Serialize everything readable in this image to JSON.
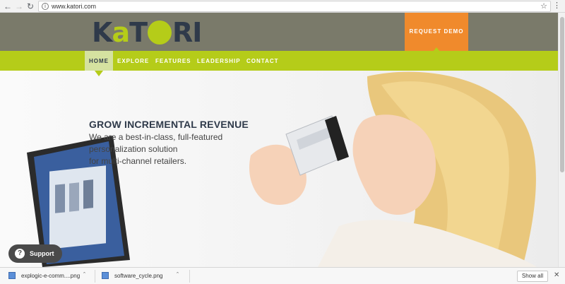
{
  "browser": {
    "url": "www.katori.com",
    "icons": [
      "back-icon",
      "forward-icon",
      "reload-icon",
      "info-icon",
      "star-icon",
      "menu-icon"
    ]
  },
  "header": {
    "logo_text": "KATORI",
    "request_demo_label": "REQUEST DEMO",
    "colors": {
      "header_bg": "#7a7a6a",
      "lime": "#b5cc19",
      "orange": "#f08a2c",
      "navy": "#2f3a4a"
    }
  },
  "nav": {
    "items": [
      {
        "label": "HOME",
        "active": true
      },
      {
        "label": "EXPLORE",
        "active": false
      },
      {
        "label": "FEATURES",
        "active": false
      },
      {
        "label": "LEADERSHIP",
        "active": false
      },
      {
        "label": "CONTACT",
        "active": false
      }
    ]
  },
  "hero": {
    "headline": "GROW INCREMENTAL REVENUE",
    "lines": [
      "We are a best-in-class, full-featured",
      "personalization solution",
      "for multi-channel retailers."
    ]
  },
  "support": {
    "label": "Support",
    "icon": "help-icon"
  },
  "downloads": {
    "items": [
      {
        "name": "explogic-e-comm....png"
      },
      {
        "name": "software_cycle.png"
      }
    ],
    "show_all_label": "Show all"
  }
}
